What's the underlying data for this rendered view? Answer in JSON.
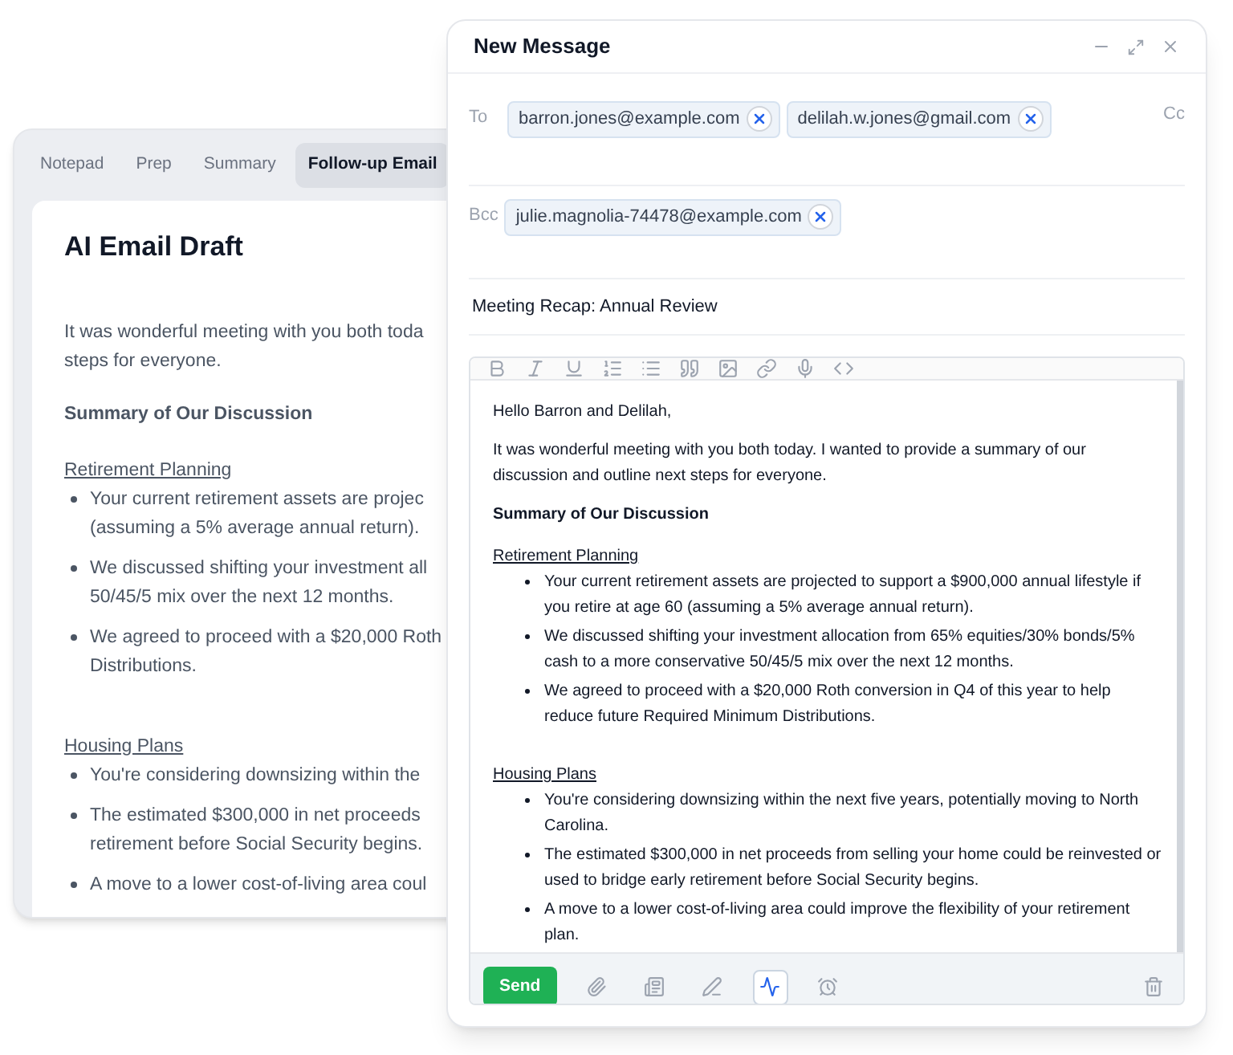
{
  "notes_panel": {
    "tabs": [
      {
        "label": "Notepad",
        "selected": false
      },
      {
        "label": "Prep",
        "selected": false
      },
      {
        "label": "Summary",
        "selected": false
      },
      {
        "label": "Follow-up Email",
        "selected": true
      }
    ],
    "title": "AI Email Draft",
    "intro_lines": [
      "It was wonderful meeting with you both toda",
      "steps for everyone."
    ],
    "heading": "Summary of Our Discussion",
    "sections": [
      {
        "title": "Retirement Planning",
        "bullets": [
          [
            "Your current retirement assets are projec",
            "(assuming a 5% average annual return)."
          ],
          [
            "We discussed shifting your investment all",
            "50/45/5 mix over the next 12 months."
          ],
          [
            "We agreed to proceed with a $20,000 Roth",
            "Distributions."
          ]
        ]
      },
      {
        "title": "Housing Plans",
        "bullets": [
          [
            "You're considering downsizing within the"
          ],
          [
            "The estimated $300,000 in net proceeds",
            "retirement before Social Security begins."
          ],
          [
            "A move to a lower cost-of-living area coul"
          ]
        ]
      }
    ]
  },
  "message": {
    "title": "New Message",
    "to_label": "To",
    "to": [
      "barron.jones@example.com",
      "delilah.w.jones@gmail.com"
    ],
    "cc_label": "Cc",
    "bcc_label": "Bcc",
    "bcc": [
      "julie.magnolia-74478@example.com"
    ],
    "subject": "Meeting Recap: Annual Review",
    "format_tools": [
      {
        "kind": "bold"
      },
      {
        "kind": "italic"
      },
      {
        "kind": "underline"
      },
      {
        "kind": "ordered-list"
      },
      {
        "kind": "bullet-list"
      },
      {
        "kind": "quote"
      },
      {
        "kind": "image"
      },
      {
        "kind": "link"
      },
      {
        "kind": "microphone"
      },
      {
        "kind": "code"
      }
    ],
    "body": {
      "greeting": "Hello Barron and Delilah,",
      "intro": "It was wonderful meeting with you both today. I wanted to provide a summary of our discussion and outline next steps for everyone.",
      "heading": "Summary of Our Discussion",
      "sections": [
        {
          "title": "Retirement Planning",
          "bullets": [
            "Your current retirement assets are projected to support a $900,000 annual lifestyle if you retire at age 60 (assuming a 5% average annual return).",
            "We discussed shifting your investment allocation from 65% equities/30% bonds/5% cash to a more conservative 50/45/5 mix over the next 12 months.",
            "We agreed to proceed with a $20,000 Roth conversion in Q4 of this year to help reduce future Required Minimum Distributions."
          ]
        },
        {
          "title": "Housing Plans",
          "bullets": [
            "You're considering downsizing within the next five years, potentially moving to North Carolina.",
            "The estimated $300,000 in net proceeds from selling your home could be reinvested or used to bridge early retirement before Social Security begins.",
            "A move to a lower cost-of-living area could improve the flexibility of your retirement plan."
          ]
        }
      ]
    },
    "send_label": "Send",
    "actions": [
      {
        "kind": "attach",
        "selected": false
      },
      {
        "kind": "template",
        "selected": false
      },
      {
        "kind": "sign",
        "selected": false
      },
      {
        "kind": "signature",
        "selected": true
      },
      {
        "kind": "schedule",
        "selected": false
      }
    ]
  }
}
